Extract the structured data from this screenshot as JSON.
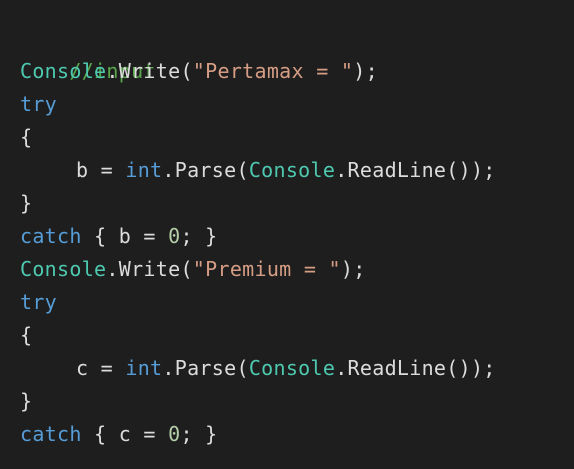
{
  "editor": {
    "colors": {
      "background": "#1e1e1e",
      "comment": "#57a64a",
      "class": "#4ec9b0",
      "keyword": "#569cd6",
      "string": "#d69d85",
      "number": "#b5cea8",
      "default": "#dcdcdc"
    },
    "lines": [
      {
        "comment": "//input"
      },
      {
        "class": "Console",
        "dot": ".",
        "method": "Write",
        "open": "(",
        "string": "\"Pertamax = \"",
        "close": ");"
      },
      {
        "keyword": "try"
      },
      {
        "brace": "{"
      },
      {
        "var": "b",
        "assign": " = ",
        "keyword": "int",
        "dot1": ".",
        "method1": "Parse",
        "open1": "(",
        "class": "Console",
        "dot2": ".",
        "method2": "ReadLine",
        "close": "());"
      },
      {
        "brace": "}"
      },
      {
        "keyword": "catch",
        "open": " { ",
        "var": "b",
        "assign": " = ",
        "number": "0",
        "close": "; }"
      },
      {
        "class": "Console",
        "dot": ".",
        "method": "Write",
        "open": "(",
        "string": "\"Premium = \"",
        "close": ");"
      },
      {
        "keyword": "try"
      },
      {
        "brace": "{"
      },
      {
        "var": "c",
        "assign": " = ",
        "keyword": "int",
        "dot1": ".",
        "method1": "Parse",
        "open1": "(",
        "class": "Console",
        "dot2": ".",
        "method2": "ReadLine",
        "close": "());"
      },
      {
        "brace": "}"
      },
      {
        "keyword": "catch",
        "open": " { ",
        "var": "c",
        "assign": " = ",
        "number": "0",
        "close": "; }"
      }
    ]
  }
}
